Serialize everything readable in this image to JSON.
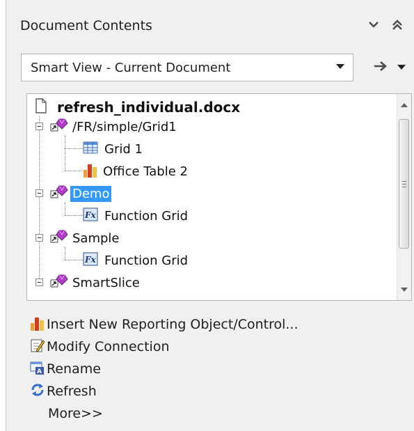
{
  "panel": {
    "title": "Document Contents",
    "collapse_icon": "chevron-down-icon",
    "maximize_icon": "double-chevron-up-icon"
  },
  "view_select": {
    "selected": "Smart View - Current Document"
  },
  "tree": {
    "root": {
      "label": "refresh_individual.docx",
      "icon": "document-icon"
    },
    "items": [
      {
        "label": "/FR/simple/Grid1",
        "icon": "connection-icon",
        "level": 1
      },
      {
        "label": "Grid 1",
        "icon": "grid-icon",
        "level": 2
      },
      {
        "label": "Office Table 2",
        "icon": "office-table-icon",
        "level": 2
      },
      {
        "label": "Demo",
        "icon": "connection-icon",
        "level": 1,
        "selected": true
      },
      {
        "label": "Function Grid",
        "icon": "function-grid-icon",
        "level": 2
      },
      {
        "label": "Sample",
        "icon": "connection-icon",
        "level": 1
      },
      {
        "label": "Function Grid",
        "icon": "function-grid-icon",
        "level": 2
      },
      {
        "label": "SmartSlice",
        "icon": "connection-icon",
        "level": 1
      }
    ]
  },
  "actions": [
    {
      "label": "Insert New Reporting Object/Control...",
      "icon": "bar-chart-icon"
    },
    {
      "label": "Modify Connection",
      "icon": "edit-connection-icon"
    },
    {
      "label": "Rename",
      "icon": "rename-icon"
    },
    {
      "label": "Refresh",
      "icon": "refresh-icon"
    },
    {
      "label": "More>>",
      "icon": ""
    }
  ],
  "colors": {
    "selection": "#3399ff",
    "connection_gem": "#b03cc8",
    "panel_bg": "#f0f0f0"
  }
}
